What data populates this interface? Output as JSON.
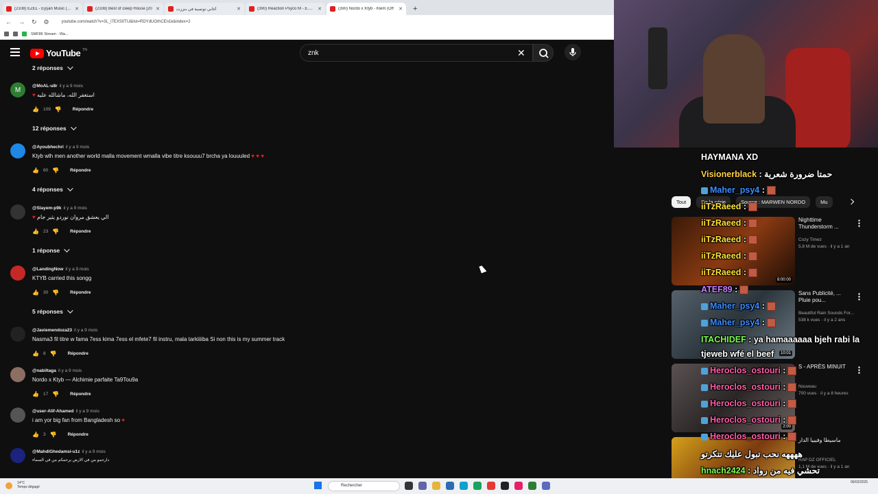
{
  "browser": {
    "tabs": [
      {
        "label": "(2108) EZEL - Eyşan Music (Um"
      },
      {
        "label": "(2108) Best of Deep House [20"
      },
      {
        "label": "أغاني تونسية في بنزرت"
      },
      {
        "label": "(390) Reaction Psyco M - E.C.T"
      },
      {
        "label": "(390) Nordo x Ktyb - Klem (Off"
      }
    ],
    "new_tab": "+",
    "url": "youtube.com/watch?v=3L_l7EXS0TU&list=RDYdUOrhCEn1k&index=2",
    "bookmark": "SMF86 Stream - Wa..."
  },
  "youtube": {
    "logo_text": "YouTube",
    "logo_sup": "TN",
    "search_query": "znk",
    "search_clear": "✕"
  },
  "comments": {
    "reply_toggles": [
      "2 réponses",
      "12 réponses",
      "4 réponses",
      "1 réponse",
      "5 réponses"
    ],
    "items": [
      {
        "author": "@MoAL-u8r",
        "time": "il y a 9 mois",
        "text": "استغفر الله، ماشالله عليه",
        "likes": "109",
        "reply": "Répondre",
        "avatar": "M",
        "avatar_color": "#2e7d32"
      },
      {
        "author": "@Ayoubhechri",
        "time": "il y a 9 mois",
        "text": "Ktyb wlh men another world malla movement wmalla vibe titre ksouuu7 brcha  ya louuuled",
        "likes": "60",
        "reply": "Répondre",
        "avatar": "",
        "avatar_color": "#1e88e5"
      },
      {
        "author": "@Slayem-p9k",
        "time": "il y a 9 mois",
        "text": "الي يعشق مروان نوردو يثير جام",
        "likes": "23",
        "reply": "Répondre",
        "avatar": "",
        "avatar_color": "#333333"
      },
      {
        "author": "@LandingNow",
        "time": "il y a 9 mois",
        "text": "KTYB carried this songg",
        "likes": "30",
        "reply": "Répondre",
        "avatar": "",
        "avatar_color": "#c62828"
      },
      {
        "author": "@Javiemendoza23",
        "time": "il y a 9 mois",
        "text": "Nasma3 fil titre w fama 7ess kima 7ess el mfete7 fil instru, mala tarkiiiiba  Si non this is my summer track",
        "likes": "8",
        "reply": "Répondre",
        "avatar": "",
        "avatar_color": "#222222"
      },
      {
        "author": "@nabiltaga",
        "time": "il y a 9 mois",
        "text": "Nordo x Ktyb — Alchimie parfaite  Ta9Tou9a",
        "likes": "17",
        "reply": "Répondre",
        "avatar": "",
        "avatar_color": "#8d6e63"
      },
      {
        "author": "@user-Alif-Ahamed",
        "time": "il y a 9 mois",
        "text": "i am yor big fan from Bangladesh so",
        "likes": "3",
        "reply": "Répondre",
        "avatar": "",
        "avatar_color": "#555555"
      },
      {
        "author": "@MahdiGhedamsi-u1z",
        "time": "il y a 9 mois",
        "text": "دارحمو من في الارض يرحمكم من في السماء",
        "likes": "",
        "reply": "",
        "avatar": "",
        "avatar_color": "#1a237e"
      }
    ]
  },
  "sidebar": {
    "chips": [
      "Tout",
      "De la série",
      "Source : MARWEN NORDO",
      "Mu"
    ],
    "videos": [
      {
        "title": "Nighttime Thunderstorm ...",
        "channel": "Cozy Timez",
        "stats": "5,8 M de vues · il y a 1 an",
        "duration": "8:00:00",
        "thumb_color": "#6b2a10"
      },
      {
        "title": "Sans Publicité, ... Pluie pou...",
        "channel": "Beautiful Rain Sounds For...",
        "stats": "538 k vues · il y a 2 ans",
        "duration": "10:01",
        "thumb_color": "#3a4652"
      },
      {
        "title": "S - APRÈS MINUIT",
        "channel": "Nouveau",
        "stats": "700 vues · il y a 8 heures",
        "duration": "2:00",
        "thumb_color": "#3b3535"
      },
      {
        "title": "ماسيطا وفيبيا الدار",
        "channel": "RAP DZ OFFICIEL",
        "stats": "1,1 M de vues · il y a 1 an",
        "duration": "",
        "thumb_color": "#b8860b"
      }
    ]
  },
  "chat": {
    "messages": [
      {
        "user": "HAYMANA XD",
        "text": "",
        "color": "#ffffff"
      },
      {
        "user": "Visionerblack",
        "text": " : حمتا ضرورة شعرية",
        "color": "#ffd23f"
      },
      {
        "user": "Maher_psy4",
        "text": " :",
        "color": "#3c8dff"
      },
      {
        "user": "iiTzRaeed",
        "text": " :",
        "color": "#ffe234"
      },
      {
        "user": "iiTzRaeed",
        "text": " :",
        "color": "#ffe234"
      },
      {
        "user": "iiTzRaeed",
        "text": " :",
        "color": "#ffe234"
      },
      {
        "user": "iiTzRaeed",
        "text": " :",
        "color": "#ffe234"
      },
      {
        "user": "iiTzRaeed",
        "text": " :",
        "color": "#ffe234"
      },
      {
        "user": "ATEF89",
        "text": " :",
        "color": "#c77dff"
      },
      {
        "user": "Maher_psy4",
        "text": " :",
        "color": "#3c8dff"
      },
      {
        "user": "Maher_psy4",
        "text": " :",
        "color": "#3c8dff"
      },
      {
        "user": "ITACHIDEF",
        "text": " : ya hamaaaaaa bjeh rabi la",
        "color": "#7cff4f"
      },
      {
        "user": "",
        "text": "tjeweb wfé el beef",
        "color": "#ffffff"
      },
      {
        "user": "Heroclos_ostouri",
        "text": " :",
        "color": "#ff5ea8"
      },
      {
        "user": "Heroclos_ostouri",
        "text": " :",
        "color": "#ff5ea8"
      },
      {
        "user": "Heroclos_ostouri",
        "text": " :",
        "color": "#ff5ea8"
      },
      {
        "user": "Heroclos_ostouri",
        "text": " :",
        "color": "#ff5ea8"
      },
      {
        "user": "Heroclos_ostouri",
        "text": " :",
        "color": "#ff5ea8"
      },
      {
        "user": "",
        "text": "ههههه نحب تبول عليك تتكرتو",
        "color": "#ffffff"
      },
      {
        "user": "hnach2424",
        "text": " : تحشي فيه من رواد",
        "color": "#7cff4f"
      }
    ]
  },
  "taskbar": {
    "temp": "14°C",
    "weather": "Temps dégagé",
    "search": "Rechercher",
    "date": "06/02/2025"
  }
}
